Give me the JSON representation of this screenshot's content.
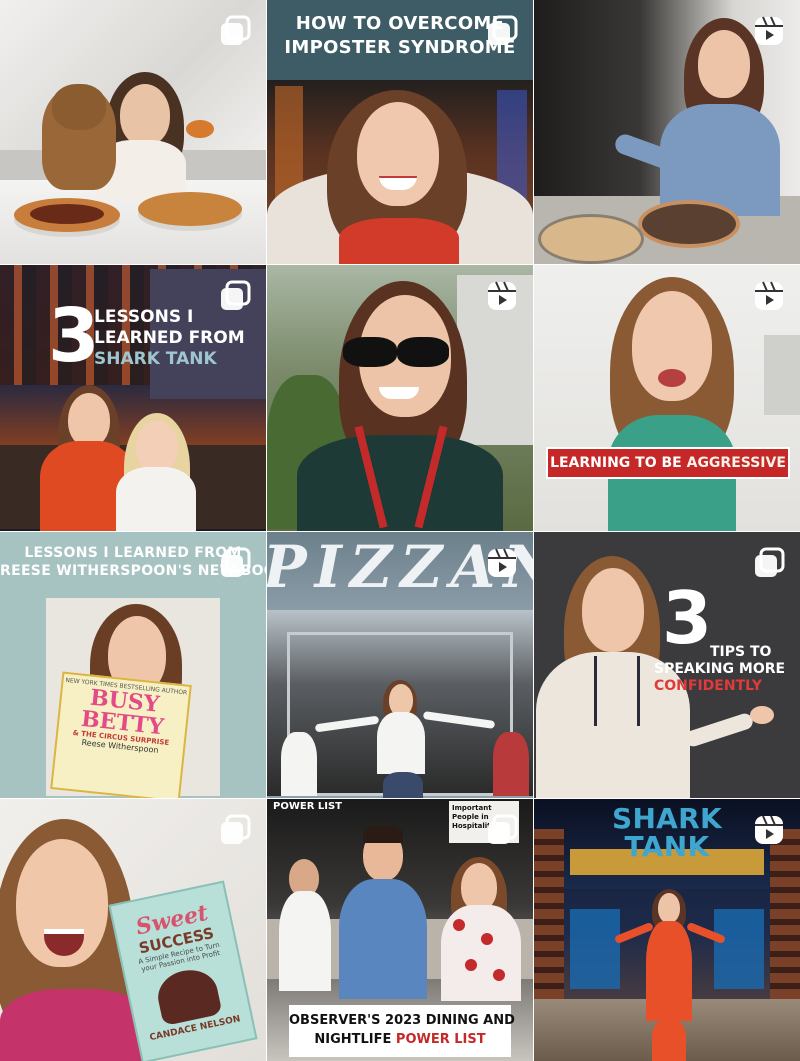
{
  "colors": {
    "teal_header": "#3d5c66",
    "sage_bg": "#a6c2c1",
    "charcoal_bg": "#3b3b3d",
    "red_banner": "#c62828",
    "accent_red": "#e03a3a"
  },
  "posts": [
    {
      "badge": "carousel-icon"
    },
    {
      "badge": "carousel-icon",
      "caption_lines": [
        "HOW TO OVERCOME",
        "IMPOSTER SYNDROME"
      ]
    },
    {
      "badge": "reels-icon"
    },
    {
      "badge": "carousel-icon",
      "big_number": "3",
      "caption_lines": [
        "LESSONS I",
        "LEARNED FROM"
      ],
      "caption_accent": "SHARK TANK"
    },
    {
      "badge": "reels-icon"
    },
    {
      "badge": "reels-icon",
      "banner_text": "LEARNING TO BE ",
      "banner_accent": "AGGRESSIVE"
    },
    {
      "badge": "carousel-icon",
      "caption_lines": [
        "LESSONS I LEARNED FROM",
        "REESE WITHERSPOON'S NEW BOOK"
      ],
      "book": {
        "title_1": "BUSY",
        "title_2": "BETTY",
        "subtitle": "& THE CIRCUS SURPRISE",
        "author": "Reese Witherspoon",
        "top": "NEW YORK TIMES BESTSELLING AUTHOR"
      }
    },
    {
      "badge": "reels-icon",
      "sign": "PIZZAN"
    },
    {
      "badge": "carousel-icon",
      "big_number": "3",
      "caption_lines": [
        "TIPS TO",
        "SPEAKING MORE"
      ],
      "caption_accent": "CONFIDENTLY"
    },
    {
      "badge": "carousel-icon",
      "book": {
        "title_1": "Sweet",
        "title_2": "SUCCESS",
        "subtitle": "A Simple Recipe to Turn your Passion into Profit",
        "author": "CANDACE NELSON"
      }
    },
    {
      "badge": "carousel-icon",
      "header": "POWER LIST",
      "sidebar_text": "Important People in Hospitality",
      "caption_lines": [
        "OBSERVER'S 2023 DINING AND"
      ],
      "caption_line2": "NIGHTLIFE ",
      "caption_accent": "POWER LIST"
    },
    {
      "badge": "reels-icon",
      "sign_lines": [
        "SHARK",
        "TANK"
      ]
    }
  ]
}
